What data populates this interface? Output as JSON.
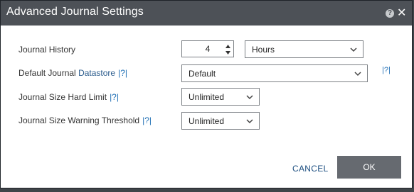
{
  "dialog": {
    "title": "Advanced Journal Settings",
    "help_icon": "question-circle-icon",
    "close_icon": "close-icon"
  },
  "fields": {
    "journal_history": {
      "label": "Journal History",
      "value": "4",
      "unit": "Hours"
    },
    "default_datastore": {
      "label_prefix": "Default Journal",
      "label_suffix": "Datastore",
      "help": "|?|",
      "value": "Default",
      "side_help": "|?|"
    },
    "hard_limit": {
      "label": "Journal Size Hard Limit",
      "help": "|?|",
      "value": "Unlimited"
    },
    "warning_threshold": {
      "label": "Journal Size Warning Threshold",
      "help": "|?|",
      "value": "Unlimited"
    }
  },
  "footer": {
    "cancel_label": "CANCEL",
    "ok_label": "OK"
  },
  "colors": {
    "titlebar": "#4d5157",
    "ok_button": "#666a70",
    "link": "#1f6fb5",
    "cancel": "#1c4e80"
  }
}
